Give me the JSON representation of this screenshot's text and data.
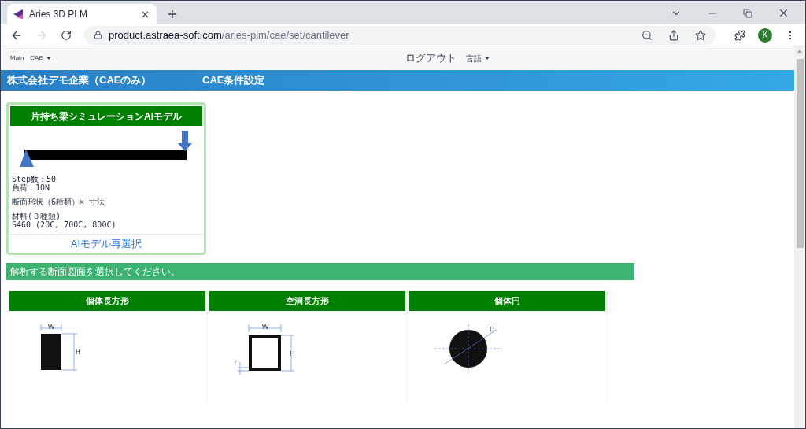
{
  "browser": {
    "tab_title": "Aries 3D PLM",
    "url_host": "product.astraea-soft.com",
    "url_path": "/aries-plm/cae/set/cantilever",
    "avatar": "K"
  },
  "nav": {
    "left": [
      "Main",
      "CAE"
    ],
    "right": [
      "ログアウト",
      "言語"
    ]
  },
  "header": {
    "company": "株式会社デモ企業（CAEのみ）",
    "title": "CAE条件設定"
  },
  "model_card": {
    "title": "片持ち梁シミュレーションAIモデル",
    "spec_groups": [
      [
        "Step数：50",
        "負荷：10N"
      ],
      [
        "断面形状（6種類）× 寸法"
      ],
      [
        "材料(３種類)",
        "S460 (20C, 700C, 800C)"
      ]
    ],
    "link": "AIモデル再選択"
  },
  "banner": "解析する断面図面を選択してください。",
  "shapes": [
    {
      "title": "個体長方形",
      "kind": "solid-rect",
      "labels": [
        "W",
        "H"
      ]
    },
    {
      "title": "空洞長方形",
      "kind": "hollow-rect",
      "labels": [
        "W",
        "H",
        "T"
      ]
    },
    {
      "title": "個体円",
      "kind": "circle",
      "labels": [
        "D"
      ]
    }
  ]
}
